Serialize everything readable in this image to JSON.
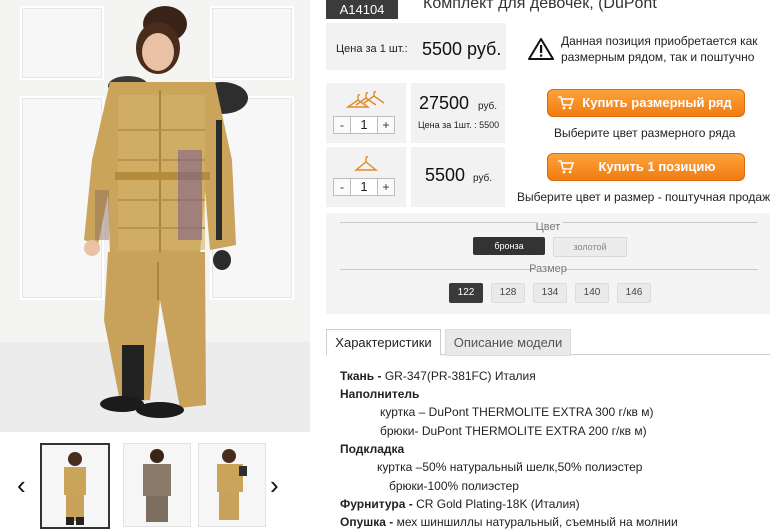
{
  "product": {
    "sku": "A14104",
    "title": "Комплект для девочек, (DuPont"
  },
  "unit_price": {
    "label": "Цена за 1 шт.:",
    "value": "5500 руб."
  },
  "notice": {
    "icon": "warning-icon",
    "line1": "Данная позиция приобретается как",
    "line2": "размерным рядом, так и поштучно"
  },
  "size_range": {
    "icon": "hangers-icon",
    "quantity": "1",
    "price": "27500",
    "currency": "руб.",
    "per_unit": "Цена за 1шт. : 5500",
    "button_label": "Купить размерный ряд",
    "hint": "Выберите цвет размерного ряда"
  },
  "single": {
    "icon": "hanger-icon",
    "quantity": "1",
    "price": "5500",
    "currency": "руб.",
    "button_label": "Купить 1 позицию",
    "hint": "Выберите цвет и размер - поштучная продажа"
  },
  "stepper": {
    "minus": "-",
    "plus": "+"
  },
  "options": {
    "color_title": "Цвет",
    "colors": [
      "бронза",
      "золотой"
    ],
    "selected_color": "бронза",
    "size_title": "Размер",
    "sizes": [
      "122",
      "128",
      "134",
      "140",
      "146"
    ],
    "selected_size": "122"
  },
  "tabs": [
    "Характеристики",
    "Описание модели"
  ],
  "specs": {
    "fabric_label": "Ткань -",
    "fabric_value": " GR-347(PR-381FC) Италия",
    "filler_label": "Наполнитель",
    "filler_jacket": "куртка – DuPont THERMOLITE EXTRA 300 г/кв м)",
    "filler_pants": "брюки- DuPont THERMOLITE EXTRA 200 г/кв м)",
    "lining_label": "Подкладка",
    "lining_jacket": "куртка –50% натуральный шелк,50% полиэстер",
    "lining_pants": "брюки-100% полиэстер",
    "hardware_label": "Фурнитура -",
    "hardware_value": " CR Gold Plating-18K (Италия)",
    "trim_label": "Опушка -",
    "trim_value": " мех шиншиллы натуральный, съемный на молнии"
  },
  "gallery": {
    "prev": "‹",
    "next": "›"
  },
  "colors": {
    "accent": "#f07b12",
    "dark": "#3b3b3b",
    "panel": "#f2f2f2"
  }
}
